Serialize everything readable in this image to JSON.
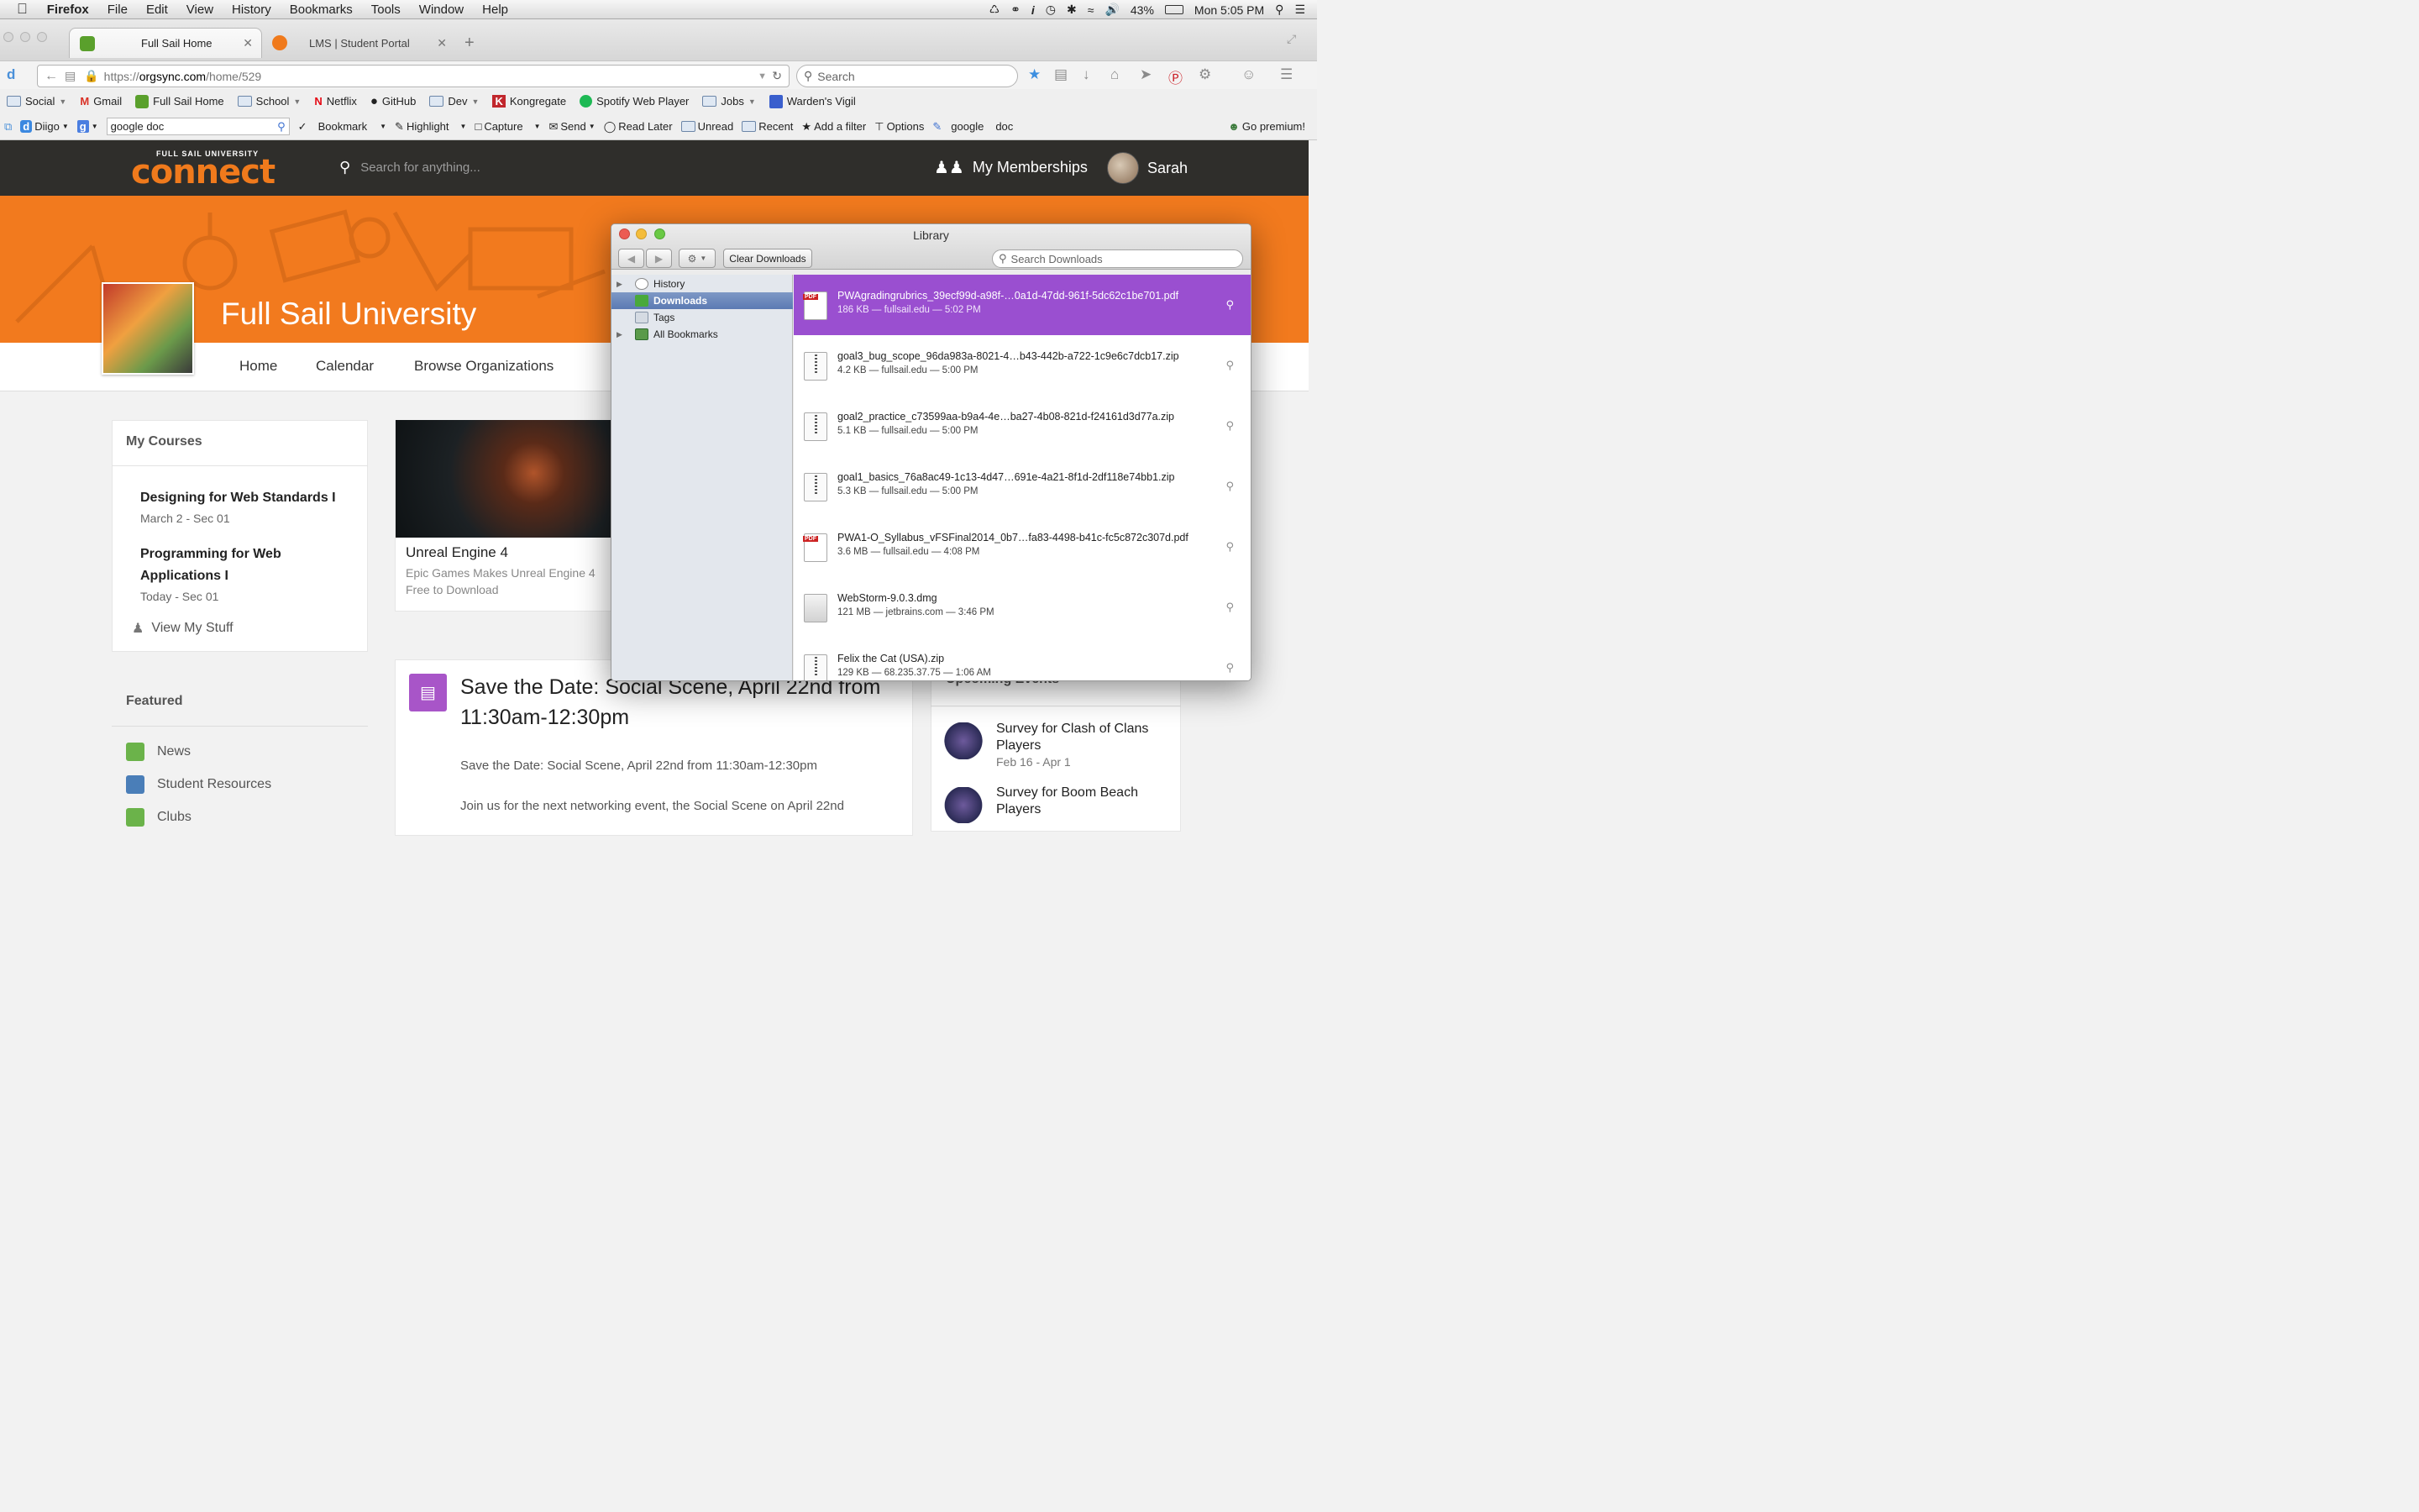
{
  "menubar": {
    "apple": "",
    "app": "Firefox",
    "items": [
      "File",
      "Edit",
      "View",
      "History",
      "Bookmarks",
      "Tools",
      "Window",
      "Help"
    ],
    "battery": "43%",
    "clock": "Mon 5:05 PM"
  },
  "tabs": [
    {
      "label": "Full Sail Home",
      "active": true
    },
    {
      "label": "LMS | Student Portal",
      "active": false
    }
  ],
  "navbar": {
    "url_prefix": "https://",
    "url_domain": "orgsync.com",
    "url_path": "/home/529",
    "search_placeholder": "Search"
  },
  "bookmarks": [
    "Social",
    "Gmail",
    "Full Sail Home",
    "School",
    "Netflix",
    "GitHub",
    "Dev",
    "Kongregate",
    "Spotify Web Player",
    "Jobs",
    "Warden's Vigil"
  ],
  "diigo": {
    "brand": "Diigo",
    "search_value": "google doc",
    "items": [
      "Bookmark",
      "Highlight",
      "Capture",
      "Send",
      "Read Later",
      "Unread",
      "Recent",
      "Add a filter",
      "Options",
      "google",
      "doc",
      "Go premium!"
    ]
  },
  "site": {
    "logo_sub": "FULL SAIL UNIVERSITY",
    "logo_main": "connect",
    "search_placeholder": "Search for anything...",
    "memberships": "My Memberships",
    "user": "Sarah",
    "org_name": "Full Sail University",
    "org_tabs": [
      "Home",
      "Calendar",
      "Browse Organizations"
    ]
  },
  "courses": {
    "title": "My Courses",
    "items": [
      {
        "name": "Designing for Web Standards I",
        "sub": "March 2 - Sec 01"
      },
      {
        "name_line1": "Programming for Web",
        "name_line2": "Applications I",
        "sub": "Today - Sec 01"
      }
    ],
    "view_stuff": "View My Stuff"
  },
  "news_card": {
    "title": "Unreal Engine 4",
    "desc1": "Epic Games Makes Unreal Engine 4",
    "desc2": "Free to Download"
  },
  "featured": {
    "title": "Featured",
    "items": [
      "News",
      "Student Resources",
      "Clubs"
    ]
  },
  "post": {
    "title1": "Save the Date: Social Scene, April 22nd from",
    "title2": "11:30am-12:30pm",
    "body1": "Save the Date: Social Scene, April 22nd from 11:30am-12:30pm",
    "body2": "Join us for the next networking event, the Social Scene on April 22nd"
  },
  "events": {
    "title": "Upcoming Events",
    "items": [
      {
        "line1": "Survey for Clash of Clans",
        "line2": "Players",
        "date": "Feb 16 - Apr 1"
      },
      {
        "line1": "Survey for Boom Beach",
        "line2": "Players",
        "date": ""
      }
    ]
  },
  "library": {
    "title": "Library",
    "clear": "Clear Downloads",
    "search_placeholder": "Search Downloads",
    "sidebar": [
      "History",
      "Downloads",
      "Tags",
      "All Bookmarks"
    ],
    "downloads": [
      {
        "name": "PWAgradingrubrics_39ecf99d-a98f-…0a1d-47dd-961f-5dc62c1be701.pdf",
        "meta": "186 KB — fullsail.edu — 5:02 PM",
        "kind": "pdf"
      },
      {
        "name": "goal3_bug_scope_96da983a-8021-4…b43-442b-a722-1c9e6c7dcb17.zip",
        "meta": "4.2 KB — fullsail.edu — 5:00 PM",
        "kind": "zip"
      },
      {
        "name": "goal2_practice_c73599aa-b9a4-4e…ba27-4b08-821d-f24161d3d77a.zip",
        "meta": "5.1 KB — fullsail.edu — 5:00 PM",
        "kind": "zip"
      },
      {
        "name": "goal1_basics_76a8ac49-1c13-4d47…691e-4a21-8f1d-2df118e74bb1.zip",
        "meta": "5.3 KB — fullsail.edu — 5:00 PM",
        "kind": "zip"
      },
      {
        "name": "PWA1-O_Syllabus_vFSFinal2014_0b7…fa83-4498-b41c-fc5c872c307d.pdf",
        "meta": "3.6 MB — fullsail.edu — 4:08 PM",
        "kind": "pdf"
      },
      {
        "name": "WebStorm-9.0.3.dmg",
        "meta": "121 MB — jetbrains.com — 3:46 PM",
        "kind": "dmg"
      },
      {
        "name": "Felix the Cat (USA).zip",
        "meta": "129 KB — 68.235.37.75 — 1:06 AM",
        "kind": "zip"
      }
    ]
  },
  "colors": {
    "accent_orange": "#f27a1e",
    "selected_purple": "#9a4fd0",
    "header_dark": "#2f2e2b"
  }
}
